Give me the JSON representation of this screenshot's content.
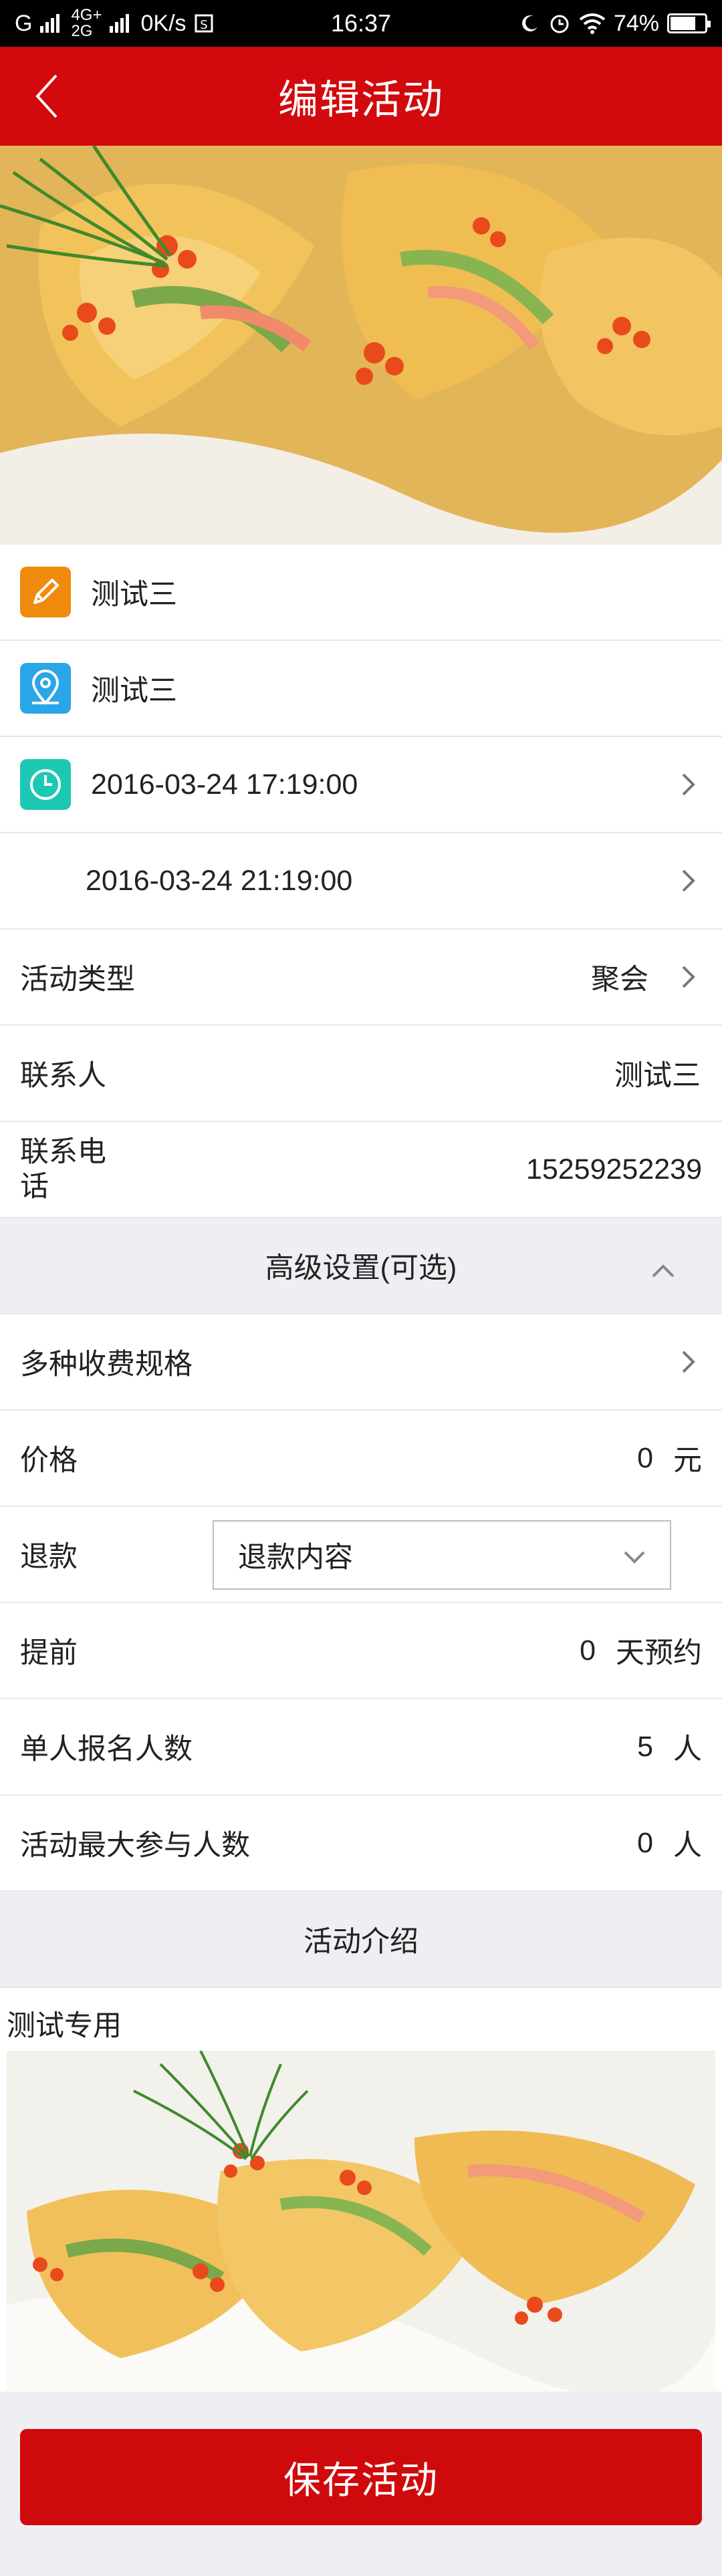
{
  "status_bar": {
    "carrier": "G",
    "network_top": "4G+",
    "network_bottom": "2G",
    "speed": "0K/s",
    "time": "16:37",
    "battery": "74%",
    "battery_level": 0.74
  },
  "header": {
    "title": "编辑活动"
  },
  "event": {
    "name": "测试三",
    "location": "测试三",
    "start_time": "2016-03-24 17:19:00",
    "end_time": "2016-03-24 21:19:00",
    "type_label": "活动类型",
    "type_value": "聚会",
    "contact_label": "联系人",
    "contact_value": "测试三",
    "phone_label": "联系电话",
    "phone_value": "15259252239"
  },
  "advanced": {
    "header": "高级设置(可选)",
    "multi_fee_label": "多种收费规格",
    "price_label": "价格",
    "price_value": "0",
    "price_unit": "元",
    "refund_label": "退款",
    "refund_select": "退款内容",
    "advance_label": "提前",
    "advance_value": "0",
    "advance_unit": "天预约",
    "per_person_label": "单人报名人数",
    "per_person_value": "5",
    "per_person_unit": "人",
    "max_label": "活动最大参与人数",
    "max_value": "0",
    "max_unit": "人"
  },
  "intro": {
    "header": "活动介绍",
    "text": "测试专用"
  },
  "actions": {
    "save_label": "保存活动"
  },
  "colors": {
    "brand_red": "#d2090d",
    "icon_orange": "#f08a0c",
    "icon_blue": "#2aa6e8",
    "icon_teal": "#1cc8b4"
  },
  "icons": {
    "name": "pen-icon",
    "location": "map-pin-icon",
    "time": "clock-icon",
    "back": "chevron-left-icon",
    "next": "chevron-right-icon"
  }
}
